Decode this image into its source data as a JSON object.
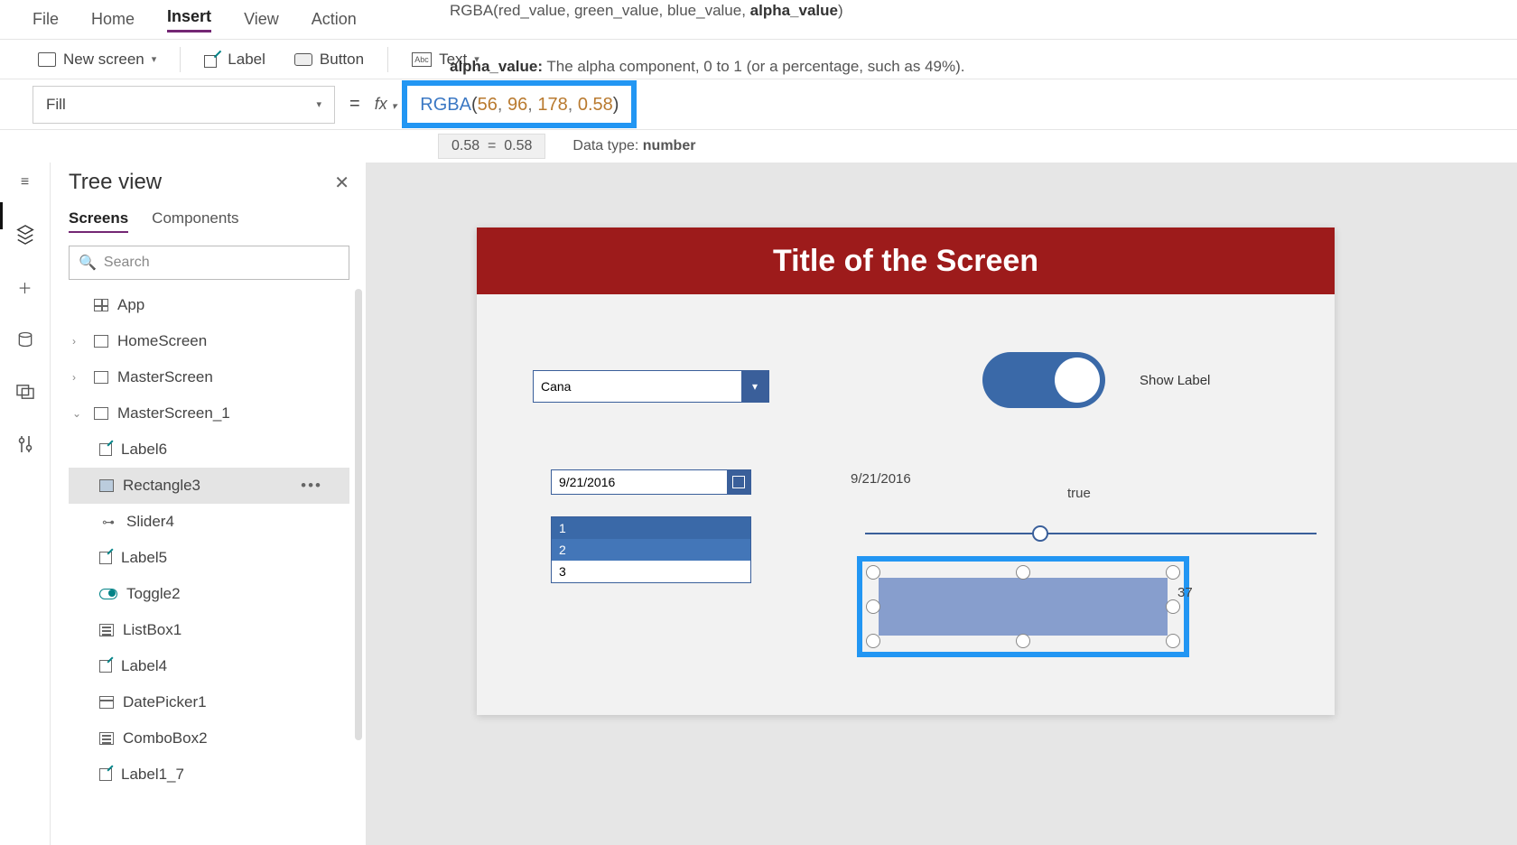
{
  "menu": {
    "file": "File",
    "home": "Home",
    "insert": "Insert",
    "view": "View",
    "action": "Action"
  },
  "ribbon": {
    "newScreen": "New screen",
    "label": "Label",
    "button": "Button",
    "text": "Text"
  },
  "hint": {
    "signature_prefix": "RGBA(red_value, green_value, blue_value, ",
    "signature_bold": "alpha_value",
    "signature_suffix": ")",
    "param_name": "alpha_value:",
    "param_desc": " The alpha component, 0 to 1 (or a percentage, such as 49%)."
  },
  "formula": {
    "property": "Fill",
    "fx": "fx",
    "fn": "RGBA",
    "args": [
      "56",
      "96",
      "178",
      "0.58"
    ],
    "result_lhs": "0.58",
    "result_rhs": "0.58",
    "datatype_label": "Data type: ",
    "datatype": "number"
  },
  "tree": {
    "title": "Tree view",
    "tab_screens": "Screens",
    "tab_components": "Components",
    "search_placeholder": "Search",
    "items": {
      "app": "App",
      "home": "HomeScreen",
      "master": "MasterScreen",
      "master1": "MasterScreen_1",
      "label6": "Label6",
      "rect3": "Rectangle3",
      "slider4": "Slider4",
      "label5": "Label5",
      "toggle2": "Toggle2",
      "listbox1": "ListBox1",
      "label4": "Label4",
      "datepicker1": "DatePicker1",
      "combobox2": "ComboBox2",
      "label1_7": "Label1_7"
    }
  },
  "canvas": {
    "title": "Title of the Screen",
    "combo_value": "Cana",
    "toggle_label": "Show Label",
    "date_value": "9/21/2016",
    "date_echo": "9/21/2016",
    "true_text": "true",
    "list": {
      "i1": "1",
      "i2": "2",
      "i3": "3"
    },
    "slider_value": "37"
  }
}
